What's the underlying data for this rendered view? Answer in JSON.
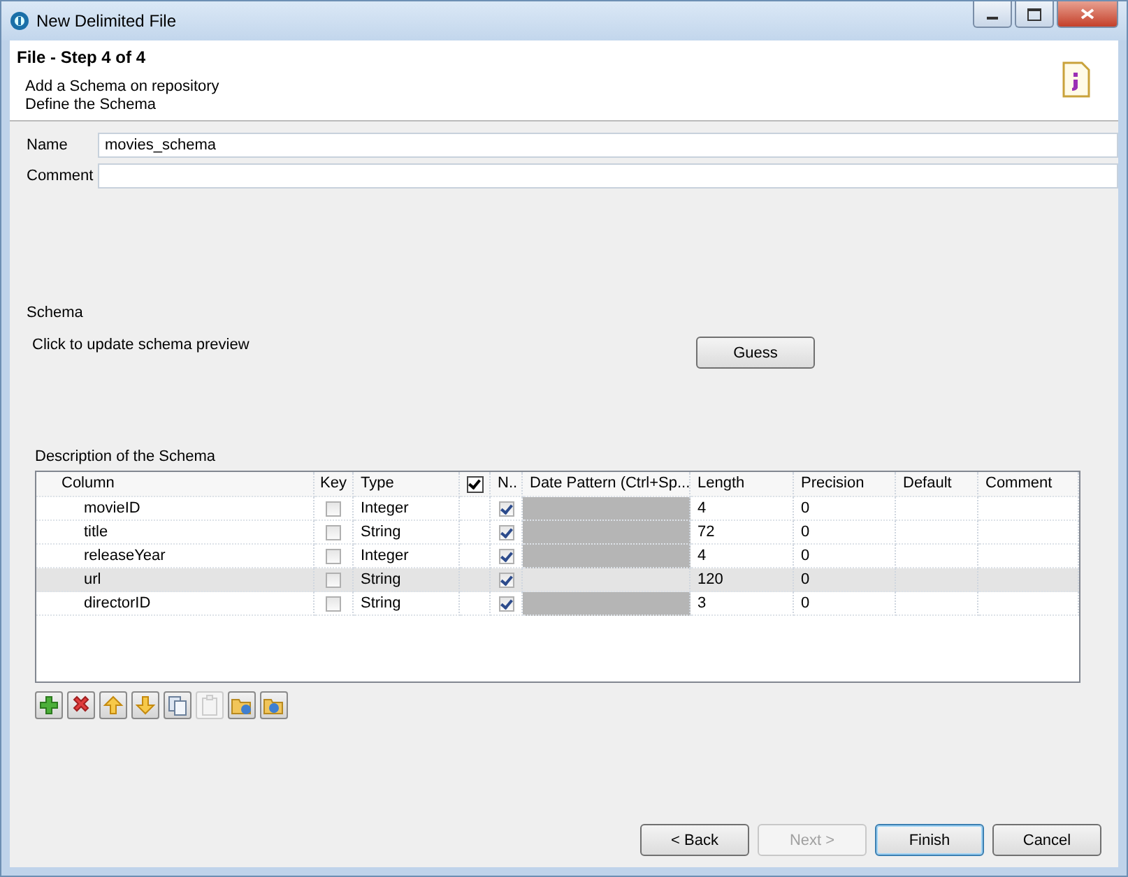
{
  "window": {
    "title": "New Delimited File"
  },
  "header": {
    "title": "File - Step 4 of 4",
    "subtitle": "Add a Schema on repository",
    "description": "Define the Schema"
  },
  "form": {
    "name_label": "Name",
    "name_value": "movies_schema",
    "comment_label": "Comment"
  },
  "schema": {
    "title": "Schema",
    "hint": "Click to update schema preview",
    "guess_button": "Guess"
  },
  "table": {
    "title": "Description of the Schema",
    "header_checked": true,
    "columns": [
      "Column",
      "Key",
      "Type",
      "N..",
      "Date Pattern (Ctrl+Sp...",
      "Length",
      "Precision",
      "Default",
      "Comment"
    ],
    "rows": [
      {
        "column": "movieID",
        "key": false,
        "type": "Integer",
        "nullable": true,
        "length": "4",
        "precision": "0",
        "selected": false
      },
      {
        "column": "title",
        "key": false,
        "type": "String",
        "nullable": true,
        "length": "72",
        "precision": "0",
        "selected": false
      },
      {
        "column": "releaseYear",
        "key": false,
        "type": "Integer",
        "nullable": true,
        "length": "4",
        "precision": "0",
        "selected": false
      },
      {
        "column": "url",
        "key": false,
        "type": "String",
        "nullable": true,
        "length": "120",
        "precision": "0",
        "selected": true
      },
      {
        "column": "directorID",
        "key": false,
        "type": "String",
        "nullable": true,
        "length": "3",
        "precision": "0",
        "selected": false
      }
    ]
  },
  "toolbar": [
    {
      "kind": "add",
      "disabled": false
    },
    {
      "kind": "remove",
      "disabled": false
    },
    {
      "kind": "up",
      "disabled": false
    },
    {
      "kind": "down",
      "disabled": false
    },
    {
      "kind": "copy",
      "disabled": false
    },
    {
      "kind": "paste",
      "disabled": true
    },
    {
      "kind": "import",
      "disabled": false
    },
    {
      "kind": "export",
      "disabled": false
    }
  ],
  "buttons": [
    {
      "label": "< Back",
      "disabled": false,
      "default": false
    },
    {
      "label": "Next >",
      "disabled": true,
      "default": false
    },
    {
      "label": "Finish",
      "disabled": false,
      "default": true
    },
    {
      "label": "Cancel",
      "disabled": false,
      "default": false
    }
  ]
}
